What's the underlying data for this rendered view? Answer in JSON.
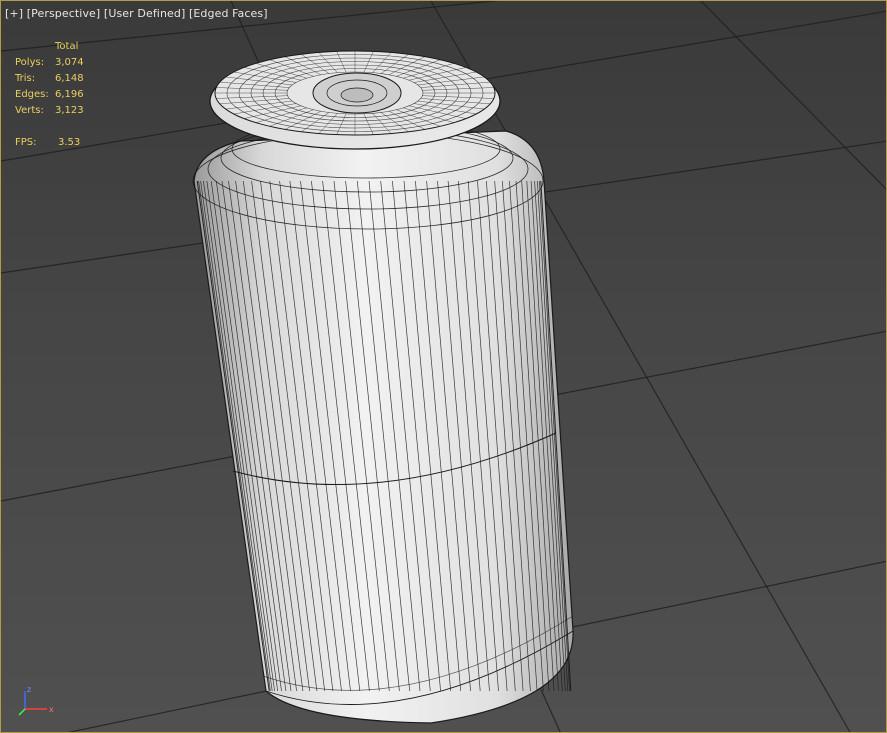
{
  "viewport": {
    "menu": {
      "plus": "[+]",
      "view": "[Perspective]",
      "shading": "[User Defined]",
      "edges": "[Edged Faces]"
    },
    "stats": {
      "header": "Total",
      "polys_label": "Polys:",
      "polys": "3,074",
      "tris_label": "Tris:",
      "tris": "6,148",
      "edges_label": "Edges:",
      "edges": "6,196",
      "verts_label": "Verts:",
      "verts": "3,123",
      "fps_label": "FPS:",
      "fps": "3.53"
    },
    "gizmo": {
      "z": "z",
      "x": "x"
    },
    "colors": {
      "border": "#b39b48",
      "stats_text": "#e8d060",
      "grid": "#1e1e1e",
      "mesh_fill": "#e4e4e4",
      "wire": "#1a1a1a"
    },
    "object": "soda-can-mesh"
  }
}
